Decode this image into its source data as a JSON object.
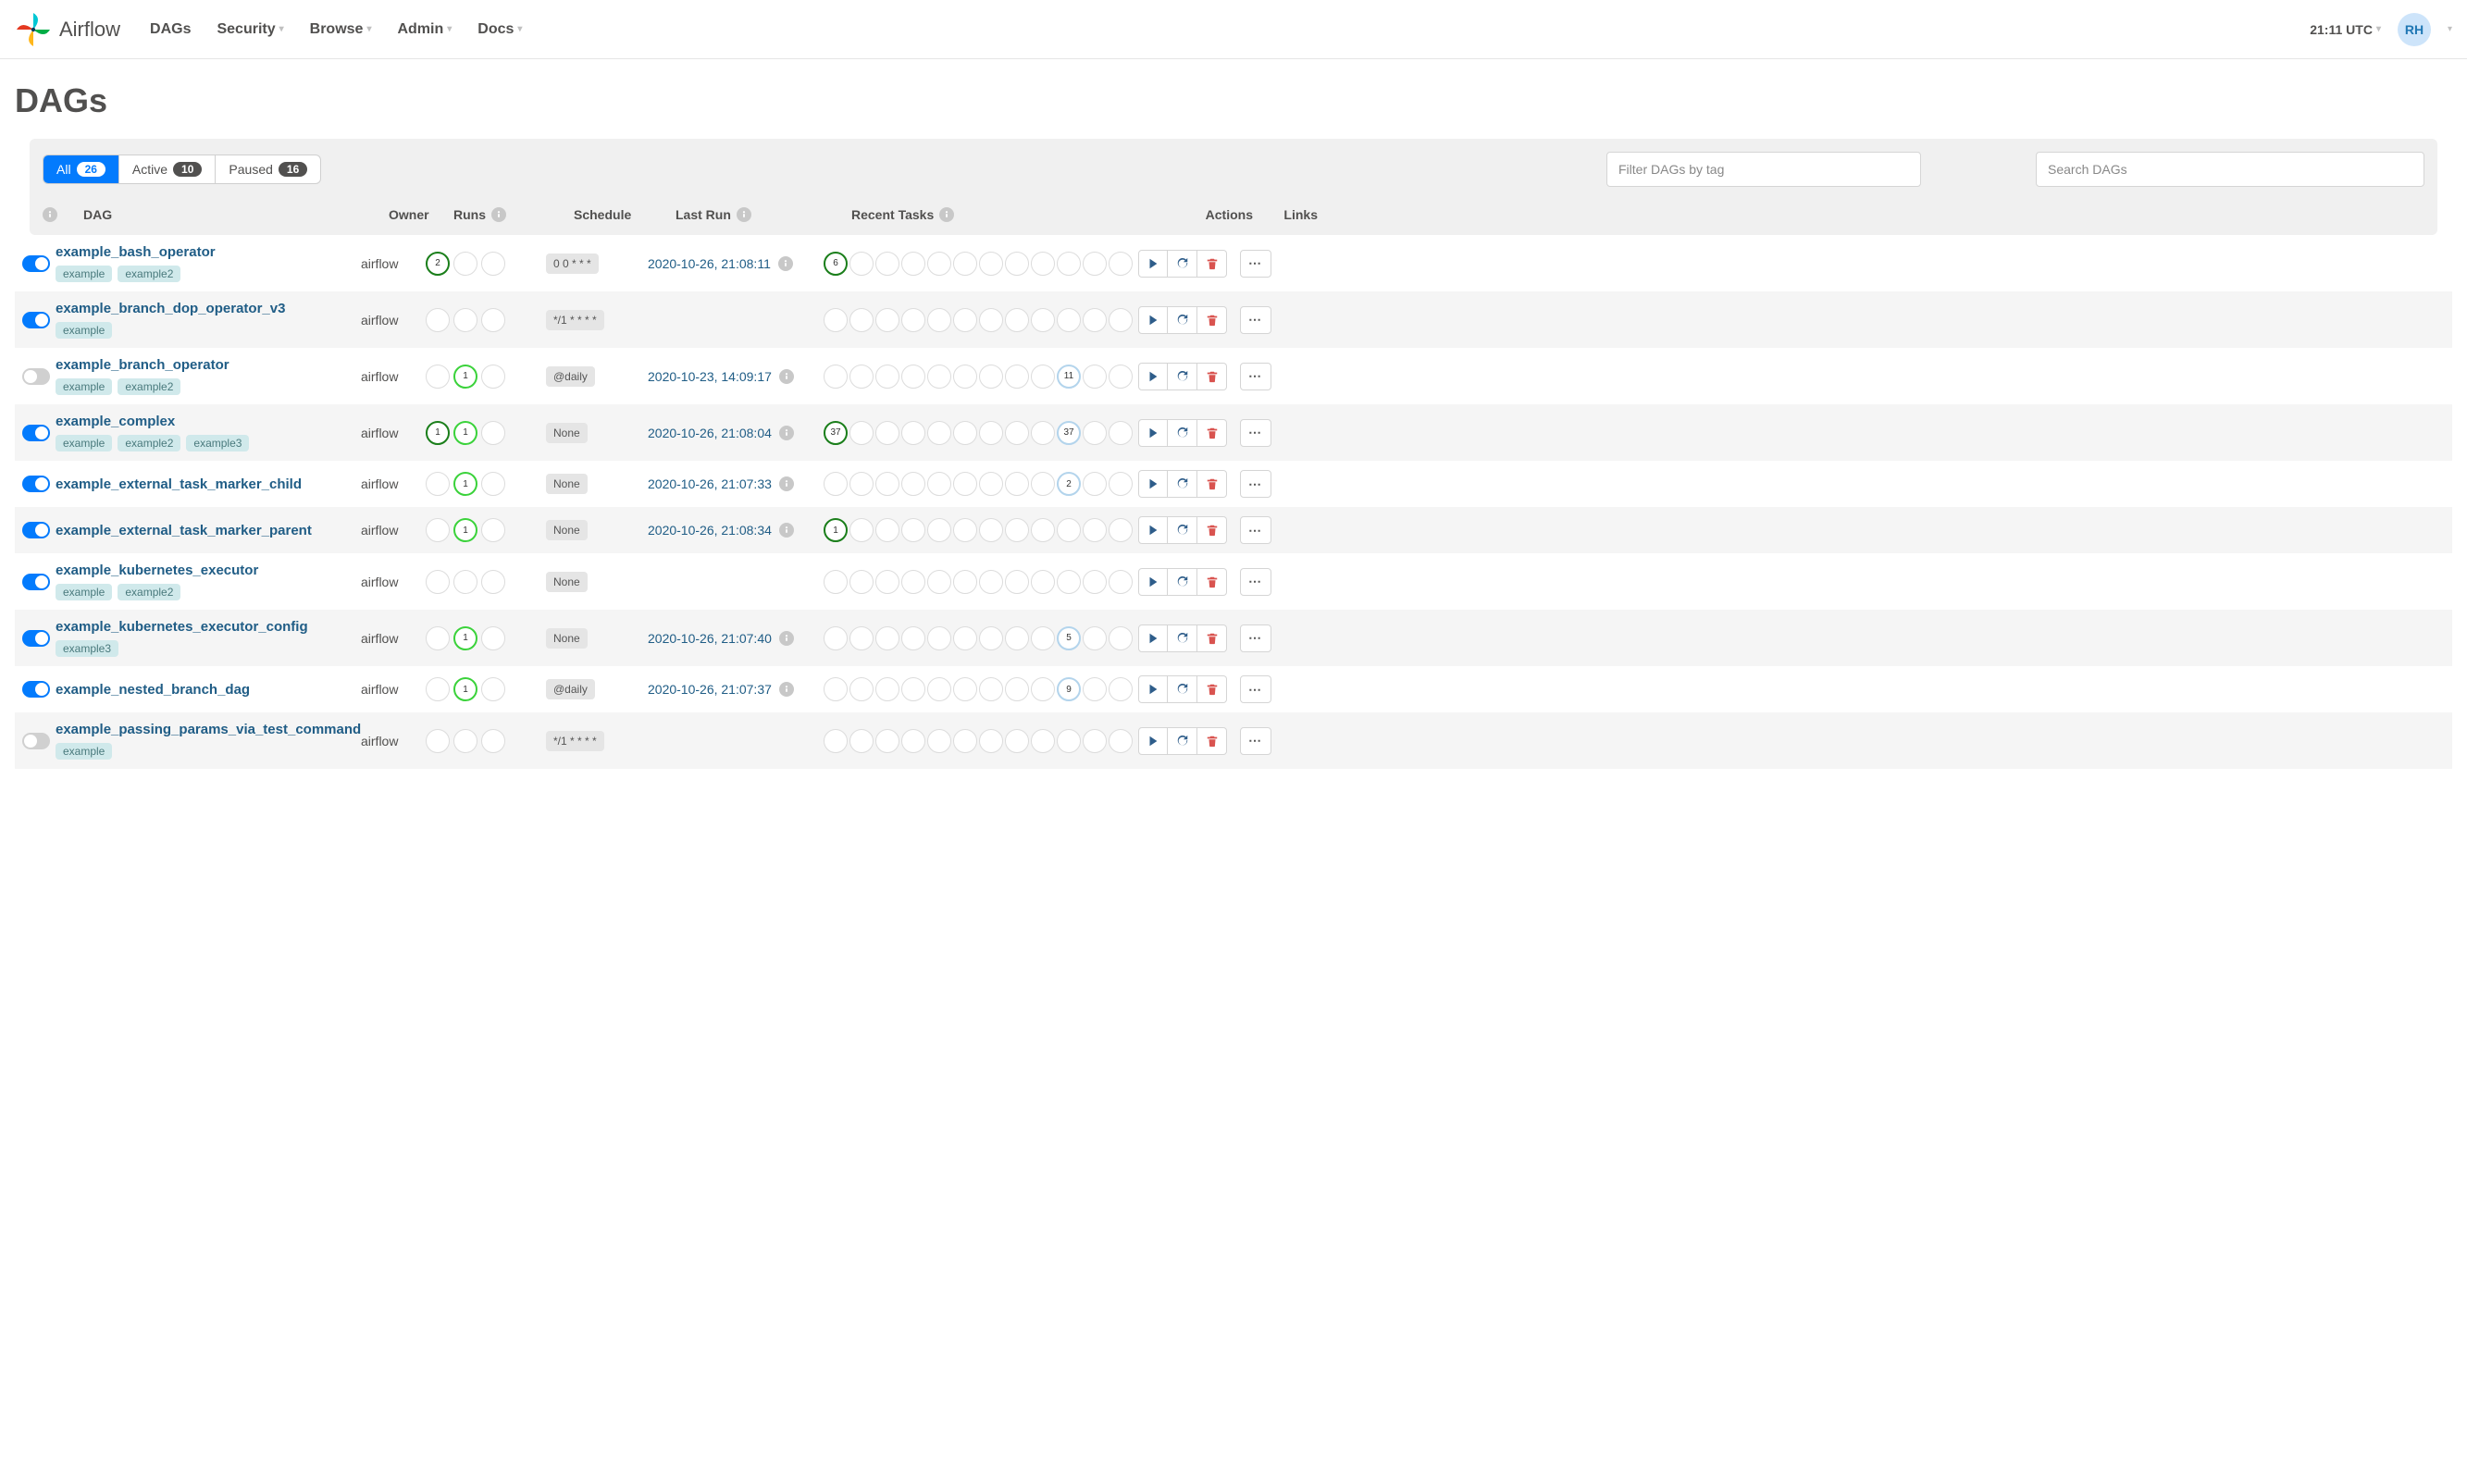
{
  "brand": "Airflow",
  "nav": [
    "DAGs",
    "Security",
    "Browse",
    "Admin",
    "Docs"
  ],
  "clock": "21:11 UTC",
  "user_initials": "RH",
  "page_title": "DAGs",
  "filters": {
    "all": {
      "label": "All",
      "count": "26"
    },
    "active": {
      "label": "Active",
      "count": "10"
    },
    "paused": {
      "label": "Paused",
      "count": "16"
    }
  },
  "filter_placeholder": "Filter DAGs by tag",
  "search_placeholder": "Search DAGs",
  "columns": {
    "dag": "DAG",
    "owner": "Owner",
    "runs": "Runs",
    "schedule": "Schedule",
    "last_run": "Last Run",
    "recent": "Recent Tasks",
    "actions": "Actions",
    "links": "Links"
  },
  "dags": [
    {
      "on": true,
      "name": "example_bash_operator",
      "tags": [
        "example",
        "example2"
      ],
      "owner": "airflow",
      "runs": [
        {
          "t": "success",
          "v": "2"
        },
        {
          "t": "empty"
        },
        {
          "t": "empty"
        }
      ],
      "schedule": "0 0 * * *",
      "last_run": "2020-10-26, 21:08:11",
      "tasks": [
        {
          "t": "success",
          "v": "6"
        },
        {
          "t": "empty"
        },
        {
          "t": "empty"
        },
        {
          "t": "empty"
        },
        {
          "t": "empty"
        },
        {
          "t": "empty"
        },
        {
          "t": "empty"
        },
        {
          "t": "empty"
        },
        {
          "t": "empty"
        },
        {
          "t": "empty"
        },
        {
          "t": "empty"
        },
        {
          "t": "empty"
        }
      ]
    },
    {
      "on": true,
      "name": "example_branch_dop_operator_v3",
      "tags": [
        "example"
      ],
      "owner": "airflow",
      "runs": [
        {
          "t": "empty"
        },
        {
          "t": "empty"
        },
        {
          "t": "empty"
        }
      ],
      "schedule": "*/1 * * * *",
      "last_run": "",
      "tasks": [
        {
          "t": "empty"
        },
        {
          "t": "empty"
        },
        {
          "t": "empty"
        },
        {
          "t": "empty"
        },
        {
          "t": "empty"
        },
        {
          "t": "empty"
        },
        {
          "t": "empty"
        },
        {
          "t": "empty"
        },
        {
          "t": "empty"
        },
        {
          "t": "empty"
        },
        {
          "t": "empty"
        },
        {
          "t": "empty"
        }
      ]
    },
    {
      "on": false,
      "name": "example_branch_operator",
      "tags": [
        "example",
        "example2"
      ],
      "owner": "airflow",
      "runs": [
        {
          "t": "empty"
        },
        {
          "t": "running",
          "v": "1"
        },
        {
          "t": "empty"
        }
      ],
      "schedule": "@daily",
      "last_run": "2020-10-23, 14:09:17",
      "tasks": [
        {
          "t": "empty"
        },
        {
          "t": "empty"
        },
        {
          "t": "empty"
        },
        {
          "t": "empty"
        },
        {
          "t": "empty"
        },
        {
          "t": "empty"
        },
        {
          "t": "empty"
        },
        {
          "t": "empty"
        },
        {
          "t": "empty"
        },
        {
          "t": "queued",
          "v": "11"
        },
        {
          "t": "empty"
        },
        {
          "t": "empty"
        }
      ]
    },
    {
      "on": true,
      "name": "example_complex",
      "tags": [
        "example",
        "example2",
        "example3"
      ],
      "owner": "airflow",
      "runs": [
        {
          "t": "success",
          "v": "1"
        },
        {
          "t": "running",
          "v": "1"
        },
        {
          "t": "empty"
        }
      ],
      "schedule": "None",
      "last_run": "2020-10-26, 21:08:04",
      "tasks": [
        {
          "t": "success",
          "v": "37"
        },
        {
          "t": "empty"
        },
        {
          "t": "empty"
        },
        {
          "t": "empty"
        },
        {
          "t": "empty"
        },
        {
          "t": "empty"
        },
        {
          "t": "empty"
        },
        {
          "t": "empty"
        },
        {
          "t": "empty"
        },
        {
          "t": "queued",
          "v": "37"
        },
        {
          "t": "empty"
        },
        {
          "t": "empty"
        }
      ]
    },
    {
      "on": true,
      "name": "example_external_task_marker_child",
      "tags": [],
      "owner": "airflow",
      "runs": [
        {
          "t": "empty"
        },
        {
          "t": "running",
          "v": "1"
        },
        {
          "t": "empty"
        }
      ],
      "schedule": "None",
      "last_run": "2020-10-26, 21:07:33",
      "tasks": [
        {
          "t": "empty"
        },
        {
          "t": "empty"
        },
        {
          "t": "empty"
        },
        {
          "t": "empty"
        },
        {
          "t": "empty"
        },
        {
          "t": "empty"
        },
        {
          "t": "empty"
        },
        {
          "t": "empty"
        },
        {
          "t": "empty"
        },
        {
          "t": "queued",
          "v": "2"
        },
        {
          "t": "empty"
        },
        {
          "t": "empty"
        }
      ]
    },
    {
      "on": true,
      "name": "example_external_task_marker_parent",
      "tags": [],
      "owner": "airflow",
      "runs": [
        {
          "t": "empty"
        },
        {
          "t": "running",
          "v": "1"
        },
        {
          "t": "empty"
        }
      ],
      "schedule": "None",
      "last_run": "2020-10-26, 21:08:34",
      "tasks": [
        {
          "t": "success",
          "v": "1"
        },
        {
          "t": "empty"
        },
        {
          "t": "empty"
        },
        {
          "t": "empty"
        },
        {
          "t": "empty"
        },
        {
          "t": "empty"
        },
        {
          "t": "empty"
        },
        {
          "t": "empty"
        },
        {
          "t": "empty"
        },
        {
          "t": "empty"
        },
        {
          "t": "empty"
        },
        {
          "t": "empty"
        }
      ]
    },
    {
      "on": true,
      "name": "example_kubernetes_executor",
      "tags": [
        "example",
        "example2"
      ],
      "owner": "airflow",
      "runs": [
        {
          "t": "empty"
        },
        {
          "t": "empty"
        },
        {
          "t": "empty"
        }
      ],
      "schedule": "None",
      "last_run": "",
      "tasks": [
        {
          "t": "empty"
        },
        {
          "t": "empty"
        },
        {
          "t": "empty"
        },
        {
          "t": "empty"
        },
        {
          "t": "empty"
        },
        {
          "t": "empty"
        },
        {
          "t": "empty"
        },
        {
          "t": "empty"
        },
        {
          "t": "empty"
        },
        {
          "t": "empty"
        },
        {
          "t": "empty"
        },
        {
          "t": "empty"
        }
      ]
    },
    {
      "on": true,
      "name": "example_kubernetes_executor_config",
      "tags": [
        "example3"
      ],
      "owner": "airflow",
      "runs": [
        {
          "t": "empty"
        },
        {
          "t": "running",
          "v": "1"
        },
        {
          "t": "empty"
        }
      ],
      "schedule": "None",
      "last_run": "2020-10-26, 21:07:40",
      "tasks": [
        {
          "t": "empty"
        },
        {
          "t": "empty"
        },
        {
          "t": "empty"
        },
        {
          "t": "empty"
        },
        {
          "t": "empty"
        },
        {
          "t": "empty"
        },
        {
          "t": "empty"
        },
        {
          "t": "empty"
        },
        {
          "t": "empty"
        },
        {
          "t": "queued",
          "v": "5"
        },
        {
          "t": "empty"
        },
        {
          "t": "empty"
        }
      ]
    },
    {
      "on": true,
      "name": "example_nested_branch_dag",
      "tags": [],
      "owner": "airflow",
      "runs": [
        {
          "t": "empty"
        },
        {
          "t": "running",
          "v": "1"
        },
        {
          "t": "empty"
        }
      ],
      "schedule": "@daily",
      "last_run": "2020-10-26, 21:07:37",
      "tasks": [
        {
          "t": "empty"
        },
        {
          "t": "empty"
        },
        {
          "t": "empty"
        },
        {
          "t": "empty"
        },
        {
          "t": "empty"
        },
        {
          "t": "empty"
        },
        {
          "t": "empty"
        },
        {
          "t": "empty"
        },
        {
          "t": "empty"
        },
        {
          "t": "queued",
          "v": "9"
        },
        {
          "t": "empty"
        },
        {
          "t": "empty"
        }
      ]
    },
    {
      "on": false,
      "name": "example_passing_params_via_test_command",
      "tags": [
        "example"
      ],
      "owner": "airflow",
      "runs": [
        {
          "t": "empty"
        },
        {
          "t": "empty"
        },
        {
          "t": "empty"
        }
      ],
      "schedule": "*/1 * * * *",
      "last_run": "",
      "tasks": [
        {
          "t": "empty"
        },
        {
          "t": "empty"
        },
        {
          "t": "empty"
        },
        {
          "t": "empty"
        },
        {
          "t": "empty"
        },
        {
          "t": "empty"
        },
        {
          "t": "empty"
        },
        {
          "t": "empty"
        },
        {
          "t": "empty"
        },
        {
          "t": "empty"
        },
        {
          "t": "empty"
        },
        {
          "t": "empty"
        }
      ]
    }
  ]
}
